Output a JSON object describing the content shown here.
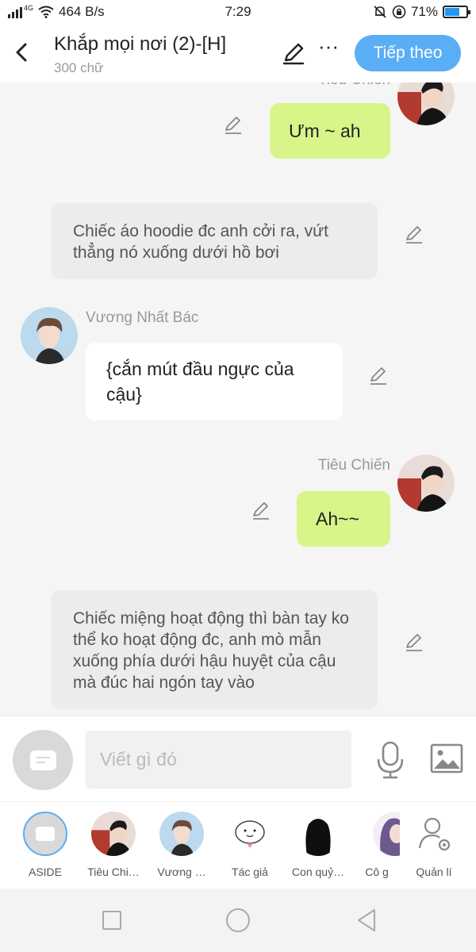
{
  "status": {
    "network": "4G",
    "speed": "464 B/s",
    "time": "7:29",
    "battery": "71%",
    "battery_level": 0.71
  },
  "header": {
    "title": "Khắp mọi nơi (2)-[H]",
    "subtitle": "300 chữ",
    "next_label": "Tiếp theo",
    "more_glyph": "···"
  },
  "messages": [
    {
      "type": "right",
      "sender": "Tiêu Chiến",
      "text": "Ưm ~ ah"
    },
    {
      "type": "narration",
      "text": "Chiếc áo hoodie đc anh cởi ra, vứt thẳng nó xuống dưới hồ bơi"
    },
    {
      "type": "left",
      "sender": "Vương Nhất Bác",
      "text": "{cắn mút đầu ngực của cậu}"
    },
    {
      "type": "right",
      "sender": "Tiêu Chiến",
      "text": "Ah~~"
    },
    {
      "type": "narration",
      "text": "Chiếc miệng hoạt động thì bàn tay ko thể ko hoạt động đc, anh mò mẫn xuống phía dưới hậu huyệt của cậu mà đúc hai ngón tay vào"
    }
  ],
  "input": {
    "placeholder": "Viết gì đó"
  },
  "roles": [
    {
      "label": "ASIDE"
    },
    {
      "label": "Tiêu Chi…"
    },
    {
      "label": "Vương …"
    },
    {
      "label": "Tác giả"
    },
    {
      "label": "Con quỷ…"
    },
    {
      "label": "Cô g"
    },
    {
      "label": "Quản lí"
    }
  ],
  "colors": {
    "accent": "#5aaef5",
    "green_bubble": "#d8f58a",
    "narration_bg": "#ececec"
  }
}
